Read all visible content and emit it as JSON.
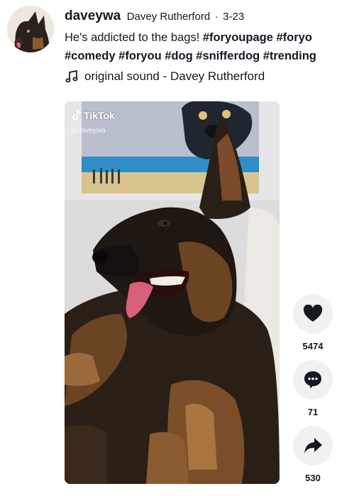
{
  "post": {
    "username": "daveywa",
    "nickname": "Davey Rutherford",
    "separator": "·",
    "date": "3-23",
    "caption_text": "He's addicted to the bags! ",
    "caption_tags_line1": [
      "#foryoupage",
      "#foryo"
    ],
    "caption_tags_line2": [
      "#comedy",
      "#foryou",
      "#dog",
      "#snifferdog",
      "#trending"
    ],
    "sound": "original sound - Davey Rutherford"
  },
  "video": {
    "watermark_brand": "TikTok",
    "watermark_user": "@daveywa"
  },
  "actions": {
    "likes": "5474",
    "comments": "71",
    "shares": "530"
  },
  "icons": {
    "note": "music-note-icon",
    "like": "heart-icon",
    "comment": "comment-bubble-icon",
    "share": "share-arrow-icon"
  },
  "colors": {
    "text": "#161823",
    "action_bg": "#f1f1f2"
  }
}
